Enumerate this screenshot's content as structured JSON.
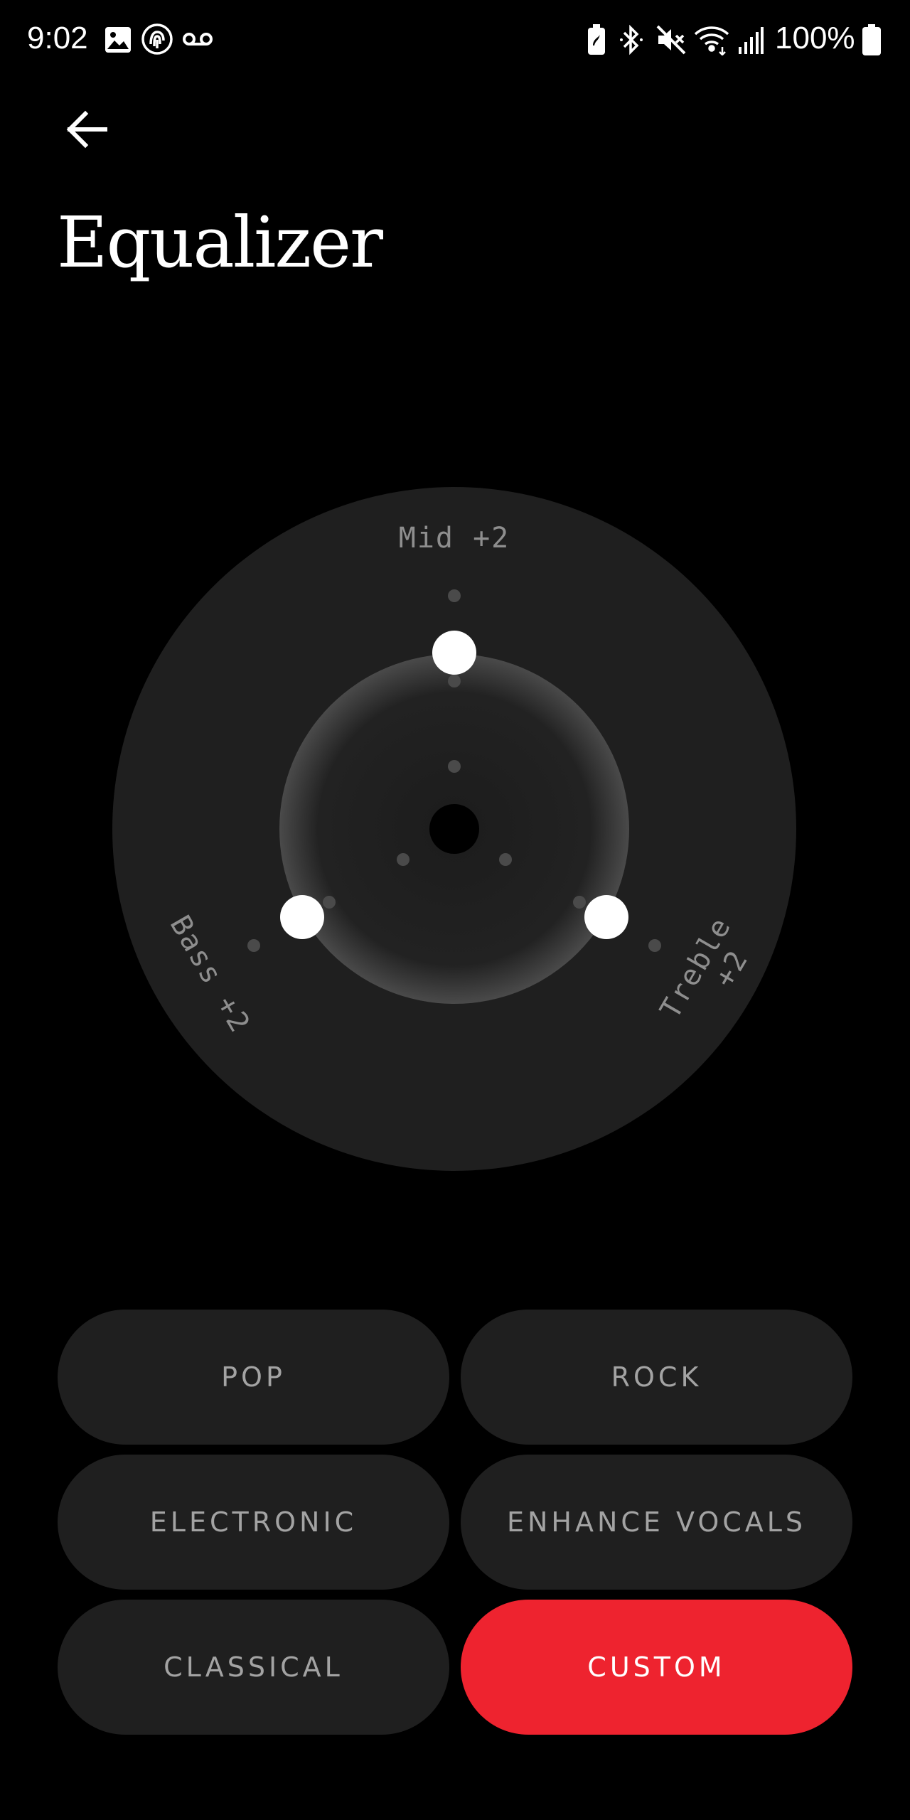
{
  "status_bar": {
    "time": "9:02",
    "left_icons": [
      "gallery-icon",
      "fingerprint-icon",
      "voicemail-icon"
    ],
    "right_icons": [
      "battery-saver-icon",
      "bluetooth-icon",
      "mute-icon",
      "wifi-icon",
      "signal-icon",
      "battery-icon"
    ],
    "battery_text": "100%"
  },
  "header": {
    "back_icon": "arrow-left-icon",
    "title": "Equalizer"
  },
  "equalizer": {
    "bands": [
      {
        "label": "Mid +2",
        "value": 2
      },
      {
        "label": "Bass +2",
        "value": 2
      },
      {
        "label": "Treble +2",
        "value": 2
      }
    ]
  },
  "presets": {
    "items": [
      {
        "label": "POP",
        "selected": false
      },
      {
        "label": "ROCK",
        "selected": false
      },
      {
        "label": "ELECTRONIC",
        "selected": false
      },
      {
        "label": "ENHANCE VOCALS",
        "selected": false
      },
      {
        "label": "CLASSICAL",
        "selected": false
      },
      {
        "label": "CUSTOM",
        "selected": true
      }
    ]
  },
  "colors": {
    "background": "#000000",
    "dial": "#1f1f1f",
    "accent": "#ee232f",
    "knob": "#ffffff",
    "muted_text": "#8e8e8e"
  }
}
